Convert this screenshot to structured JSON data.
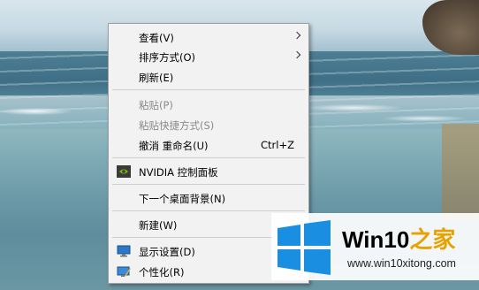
{
  "menu": {
    "items": [
      {
        "label": "查看(V)"
      },
      {
        "label": "排序方式(O)"
      },
      {
        "label": "刷新(E)"
      },
      {
        "label": "粘贴(P)"
      },
      {
        "label": "粘贴快捷方式(S)"
      },
      {
        "label": "撤消 重命名(U)",
        "shortcut": "Ctrl+Z"
      },
      {
        "label": "NVIDIA 控制面板",
        "icon": "nvidia-icon"
      },
      {
        "label": "下一个桌面背景(N)"
      },
      {
        "label": "新建(W)"
      },
      {
        "label": "显示设置(D)",
        "icon": "display-settings-icon"
      },
      {
        "label": "个性化(R)",
        "icon": "personalize-icon"
      }
    ]
  },
  "watermark": {
    "title_part1": "Win10",
    "title_part2": "之家",
    "url": "www.win10xitong.com",
    "colors": {
      "logo_blue": "#1a8ee0",
      "accent": "#e8a200"
    }
  }
}
